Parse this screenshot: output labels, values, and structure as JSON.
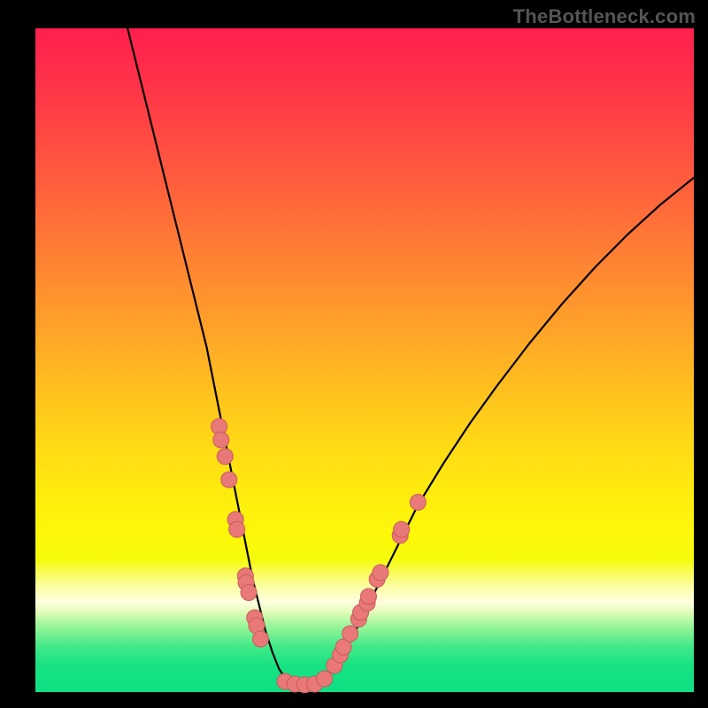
{
  "watermark": "TheBottleneck.com",
  "colors": {
    "curve": "#000000",
    "dot_fill": "#e97878",
    "dot_stroke": "#c95b5b",
    "band_top": "#ff1f4e",
    "band_mid": "#ffd716",
    "band_bottom": "#0ee083",
    "page_bg": "#000000"
  },
  "chart_data": {
    "type": "line",
    "title": "",
    "xlabel": "",
    "ylabel": "",
    "xlim": [
      0,
      100
    ],
    "ylim": [
      0,
      100
    ],
    "grid": false,
    "series": [
      {
        "name": "bottleneck-curve",
        "x": [
          14,
          16,
          18,
          20,
          22,
          24,
          26,
          27,
          28,
          29,
          30,
          31,
          32,
          33,
          34,
          35,
          36,
          37,
          38,
          39,
          40,
          41,
          42,
          43,
          44,
          45,
          46,
          48,
          50,
          52,
          55,
          58,
          62,
          66,
          70,
          75,
          80,
          85,
          90,
          95,
          100
        ],
        "y": [
          100,
          92,
          84,
          76,
          68,
          60,
          52,
          47,
          42,
          37,
          32,
          27,
          22,
          17,
          13,
          9,
          6,
          3.5,
          2,
          1.2,
          1,
          1,
          1.2,
          1.6,
          2.1,
          3.2,
          4.6,
          8,
          12,
          16,
          22,
          28,
          34.5,
          40.5,
          46,
          52.5,
          58.5,
          64,
          69,
          73.5,
          77.5
        ]
      }
    ],
    "markers": [
      {
        "series": "left-branch",
        "x": 27.9,
        "y": 40.0
      },
      {
        "series": "left-branch",
        "x": 28.2,
        "y": 38.0
      },
      {
        "series": "left-branch",
        "x": 28.8,
        "y": 35.5
      },
      {
        "series": "left-branch",
        "x": 29.4,
        "y": 32.0
      },
      {
        "series": "left-branch",
        "x": 30.4,
        "y": 26.0
      },
      {
        "series": "left-branch",
        "x": 30.6,
        "y": 24.5
      },
      {
        "series": "left-branch",
        "x": 31.9,
        "y": 17.5
      },
      {
        "series": "left-branch",
        "x": 32.0,
        "y": 16.5
      },
      {
        "series": "left-branch",
        "x": 32.4,
        "y": 15.0
      },
      {
        "series": "left-branch",
        "x": 33.3,
        "y": 11.2
      },
      {
        "series": "left-branch",
        "x": 33.6,
        "y": 10.0
      },
      {
        "series": "left-branch",
        "x": 34.2,
        "y": 8.0
      },
      {
        "series": "valley",
        "x": 37.9,
        "y": 1.6
      },
      {
        "series": "valley",
        "x": 39.4,
        "y": 1.2
      },
      {
        "series": "valley",
        "x": 40.9,
        "y": 1.1
      },
      {
        "series": "valley",
        "x": 42.4,
        "y": 1.2
      },
      {
        "series": "valley",
        "x": 43.9,
        "y": 2.0
      },
      {
        "series": "right-branch",
        "x": 45.4,
        "y": 4.0
      },
      {
        "series": "right-branch",
        "x": 46.3,
        "y": 5.6
      },
      {
        "series": "right-branch",
        "x": 46.8,
        "y": 6.8
      },
      {
        "series": "right-branch",
        "x": 47.8,
        "y": 8.8
      },
      {
        "series": "right-branch",
        "x": 49.1,
        "y": 11.0
      },
      {
        "series": "right-branch",
        "x": 49.4,
        "y": 12.0
      },
      {
        "series": "right-branch",
        "x": 50.4,
        "y": 13.4
      },
      {
        "series": "right-branch",
        "x": 50.6,
        "y": 14.4
      },
      {
        "series": "right-branch",
        "x": 51.9,
        "y": 17.0
      },
      {
        "series": "right-branch",
        "x": 52.4,
        "y": 18.0
      },
      {
        "series": "right-branch",
        "x": 55.4,
        "y": 23.6
      },
      {
        "series": "right-branch",
        "x": 55.6,
        "y": 24.5
      },
      {
        "series": "right-branch",
        "x": 58.1,
        "y": 28.6
      }
    ],
    "annotations": []
  }
}
